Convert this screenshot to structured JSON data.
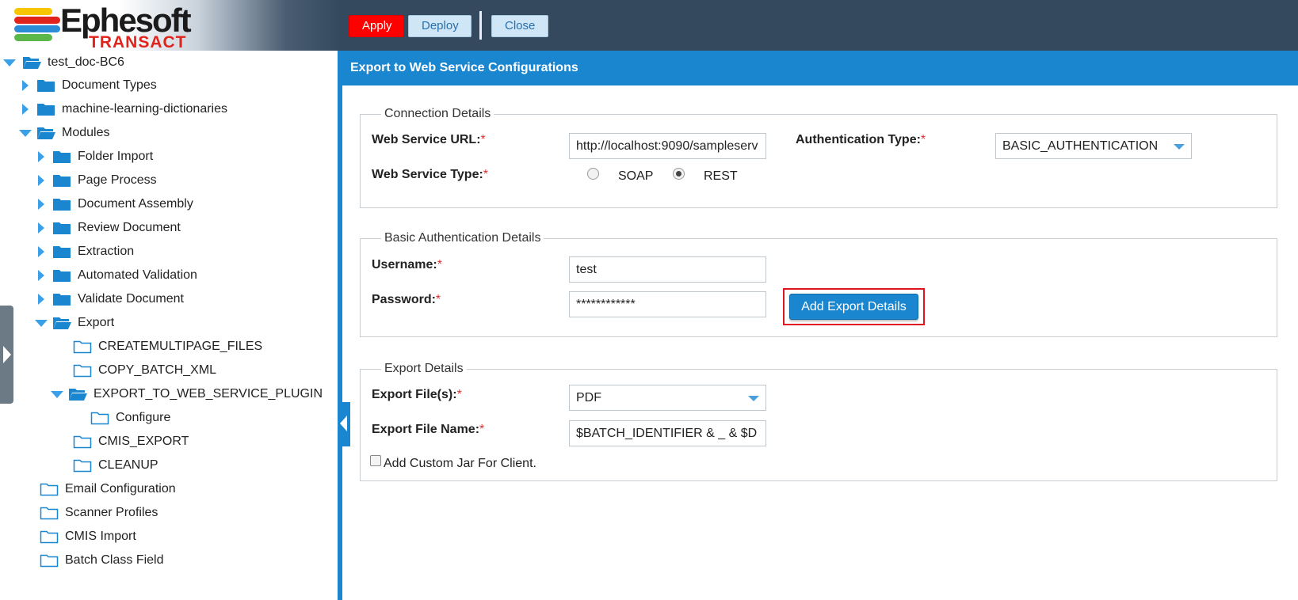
{
  "app": {
    "brand_name": "Ephesoft",
    "brand_sub": "TRANSACT",
    "logo_colors": [
      "#f7c600",
      "#e0231b",
      "#2a8bd6",
      "#5cb74b"
    ]
  },
  "toolbar": {
    "apply_label": "Apply",
    "deploy_label": "Deploy",
    "close_label": "Close"
  },
  "tree": {
    "root": "test_doc-BC6",
    "items": {
      "document_types": "Document Types",
      "ml_dictionaries": "machine-learning-dictionaries",
      "modules": "Modules",
      "folder_import": "Folder Import",
      "page_process": "Page Process",
      "document_assembly": "Document Assembly",
      "review_document": "Review Document",
      "extraction": "Extraction",
      "automated_validation": "Automated Validation",
      "validate_document": "Validate Document",
      "export": "Export",
      "createmultipage_files": "CREATEMULTIPAGE_FILES",
      "copy_batch_xml": "COPY_BATCH_XML",
      "export_to_web_service_plugin": "EXPORT_TO_WEB_SERVICE_PLUGIN",
      "configure": "Configure",
      "cmis_export": "CMIS_EXPORT",
      "cleanup": "CLEANUP",
      "email_configuration": "Email Configuration",
      "scanner_profiles": "Scanner Profiles",
      "cmis_import": "CMIS Import",
      "batch_class_field": "Batch Class Field"
    }
  },
  "panel": {
    "title": "Export to Web Service Configurations",
    "connection": {
      "legend": "Connection Details",
      "url_label": "Web Service URL:",
      "url_value": "http://localhost:9090/sampleserv",
      "auth_type_label": "Authentication Type:",
      "auth_type_value": "BASIC_AUTHENTICATION",
      "type_label": "Web Service Type:",
      "soap_label": "SOAP",
      "rest_label": "REST",
      "selected_type": "REST"
    },
    "basic_auth": {
      "legend": "Basic Authentication Details",
      "username_label": "Username:",
      "username_value": "test",
      "password_label": "Password:",
      "password_value": "************",
      "add_button": "Add Export Details"
    },
    "export": {
      "legend": "Export Details",
      "files_label": "Export File(s):",
      "files_value": "PDF",
      "name_label": "Export File Name:",
      "name_value": "$BATCH_IDENTIFIER & _ & $D",
      "custom_jar_label": "Add Custom Jar For Client."
    },
    "required_mark": "*"
  },
  "colors": {
    "header_bg": "#34495e",
    "accent_blue": "#1a86d0",
    "apply_red": "#ff0000",
    "highlight_red": "#e0141e",
    "folder_blue": "#1a86d0"
  }
}
